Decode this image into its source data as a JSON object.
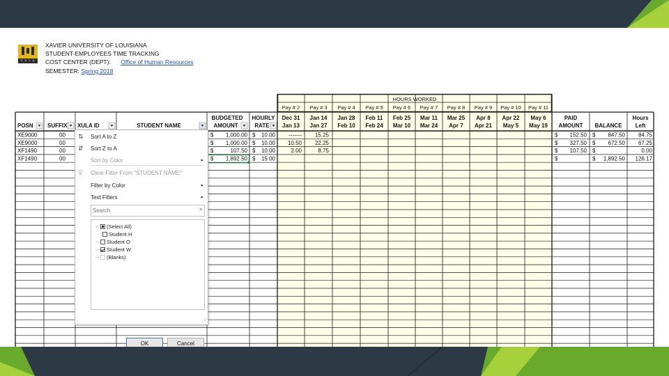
{
  "colors": {
    "frame": "#2c3a45",
    "accent_green": "#6aaa2b",
    "accent_light": "#a6d13a",
    "cell_fill": "#fefee9",
    "grid": "#1a1a1a"
  },
  "header": {
    "line1": "XAVIER UNIVERSITY OF LOUISIANA",
    "line2": "STUDENT-EMPLOYEES TIME TRACKING",
    "cost_center_label": "COST CENTER (DEPT):",
    "cost_center_value": "Office of Human Resources",
    "semester_label": "SEMESTER:",
    "semester_value": "Spring 2018",
    "logo_text": "X U L A"
  },
  "hours_worked_label": "HOURS WORKED",
  "pay_labels": [
    "Pay # 2",
    "Pay # 3",
    "Pay # 4",
    "Pay # 5",
    "Pay # 6",
    "Pay # 7",
    "Pay # 8",
    "Pay # 9",
    "Pay # 10",
    "Pay # 11"
  ],
  "columns": {
    "posn": "POSN",
    "suffix": "SUFFIX",
    "xula_id": "XULA ID",
    "student_name": "STUDENT NAME",
    "budgeted_1": "BUDGETED",
    "budgeted_2": "AMOUNT",
    "hourly_1": "HOURLY",
    "hourly_2": "RATE",
    "paid_1": "PAID",
    "paid_2": "AMOUNT",
    "balance": "BALANCE",
    "hours_left_1": "Hours",
    "hours_left_2": "Left"
  },
  "periods": [
    {
      "from": "Dec 31",
      "to": "Jan 13"
    },
    {
      "from": "Jan 14",
      "to": "Jan 27"
    },
    {
      "from": "Jan 28",
      "to": "Feb 10"
    },
    {
      "from": "Feb 11",
      "to": "Feb 24"
    },
    {
      "from": "Feb 25",
      "to": "Mar 10"
    },
    {
      "from": "Mar 11",
      "to": "Mar 24"
    },
    {
      "from": "Mar 25",
      "to": "Apr 7"
    },
    {
      "from": "Apr 8",
      "to": "Apr 21"
    },
    {
      "from": "Apr 22",
      "to": "May 5"
    },
    {
      "from": "May 6",
      "to": "May 19"
    }
  ],
  "rows": [
    {
      "posn": "XE9000",
      "suffix": "00",
      "budget": "1,000.00",
      "rate": "10.00",
      "h1": "-------",
      "h2": "15.25",
      "paid": "152.50",
      "balance": "847.50",
      "left": "84.75"
    },
    {
      "posn": "XE9000",
      "suffix": "00",
      "budget": "1,000.00",
      "rate": "10.00",
      "h1": "10.50",
      "h2": "22.25",
      "paid": "327.50",
      "balance": "672.50",
      "left": "67.25"
    },
    {
      "posn": "XF1490",
      "suffix": "00",
      "budget": "107.50",
      "rate": "10.00",
      "h1": "2.00",
      "h2": "8.75",
      "paid": "107.50",
      "balance": "",
      "left": "0.00"
    },
    {
      "posn": "XF1490",
      "suffix": "00",
      "budget": "1,892.50",
      "rate": "15.00",
      "h1": "",
      "h2": "",
      "paid": "",
      "balance": "1,892.50",
      "left": "126.17"
    }
  ],
  "currency": "$",
  "filter_menu": {
    "sort_az": "Sort A to Z",
    "sort_za": "Sort Z to A",
    "sort_color": "Sort by Color",
    "clear_filter": "Clear Filter From \"STUDENT NAME\"",
    "filter_color": "Filter by Color",
    "text_filters": "Text Filters",
    "search_placeholder": "Search",
    "items": [
      {
        "label": "(Select All)",
        "state": "partial"
      },
      {
        "label": "Student H",
        "state": "unchecked"
      },
      {
        "label": "Student O",
        "state": "unchecked"
      },
      {
        "label": "Student W",
        "state": "checked"
      },
      {
        "label": "(Blanks)",
        "state": "none"
      }
    ],
    "ok": "OK",
    "cancel": "Cancel"
  },
  "icons": [
    "sort-az-icon",
    "sort-za-icon",
    "clear-filter-icon",
    "search-icon",
    "submenu-arrow-icon",
    "filter-dropdown-icon",
    "university-logo"
  ]
}
